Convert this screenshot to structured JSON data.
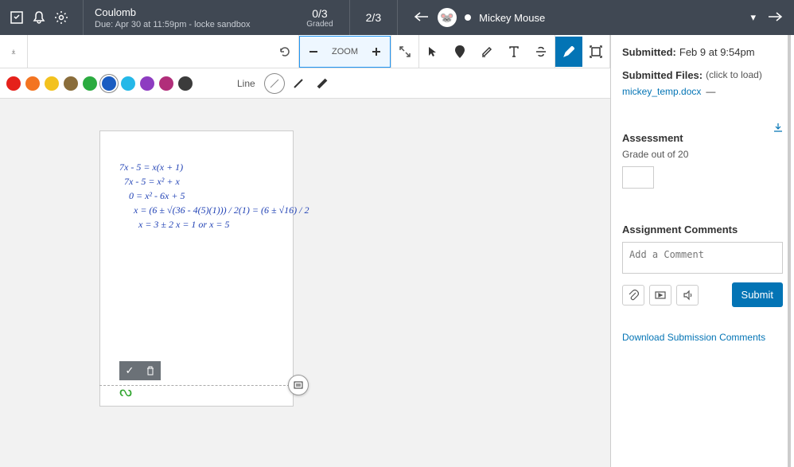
{
  "header": {
    "title": "Coulomb",
    "subtitle": "Due: Apr 30 at 11:59pm - locke sandbox",
    "graded_count": "0/3",
    "graded_label": "Graded",
    "position": "2/3",
    "user_name": "Mickey Mouse"
  },
  "toolbar": {
    "zoom_label": "ZOOM",
    "line_label": "Line"
  },
  "colors": [
    "#e5211b",
    "#f37421",
    "#f3c21e",
    "#8a6d3b",
    "#2bab40",
    "#1a5cc1",
    "#25b8e8",
    "#8e3cc1",
    "#b12e7a",
    "#3b3b3b"
  ],
  "handwriting": [
    "7x - 5 = x(x + 1)",
    "7x - 5 = x² + x",
    "0 = x² - 6x + 5",
    "x = (6 ± √(36 - 4(5)(1))) / 2(1)  =  (6 ± √16) / 2",
    "x = 3 ± 2    x = 1  or  x = 5"
  ],
  "sidebar": {
    "submitted_label": "Submitted:",
    "submitted_value": "Feb 9 at 9:54pm",
    "files_label": "Submitted Files:",
    "files_hint": "(click to load)",
    "file_name": "mickey_temp.docx",
    "file_dash": "—",
    "assessment_label": "Assessment",
    "grade_label": "Grade out of 20",
    "comments_label": "Assignment Comments",
    "comment_placeholder": "Add a Comment",
    "submit_label": "Submit",
    "download_comments": "Download Submission Comments"
  }
}
